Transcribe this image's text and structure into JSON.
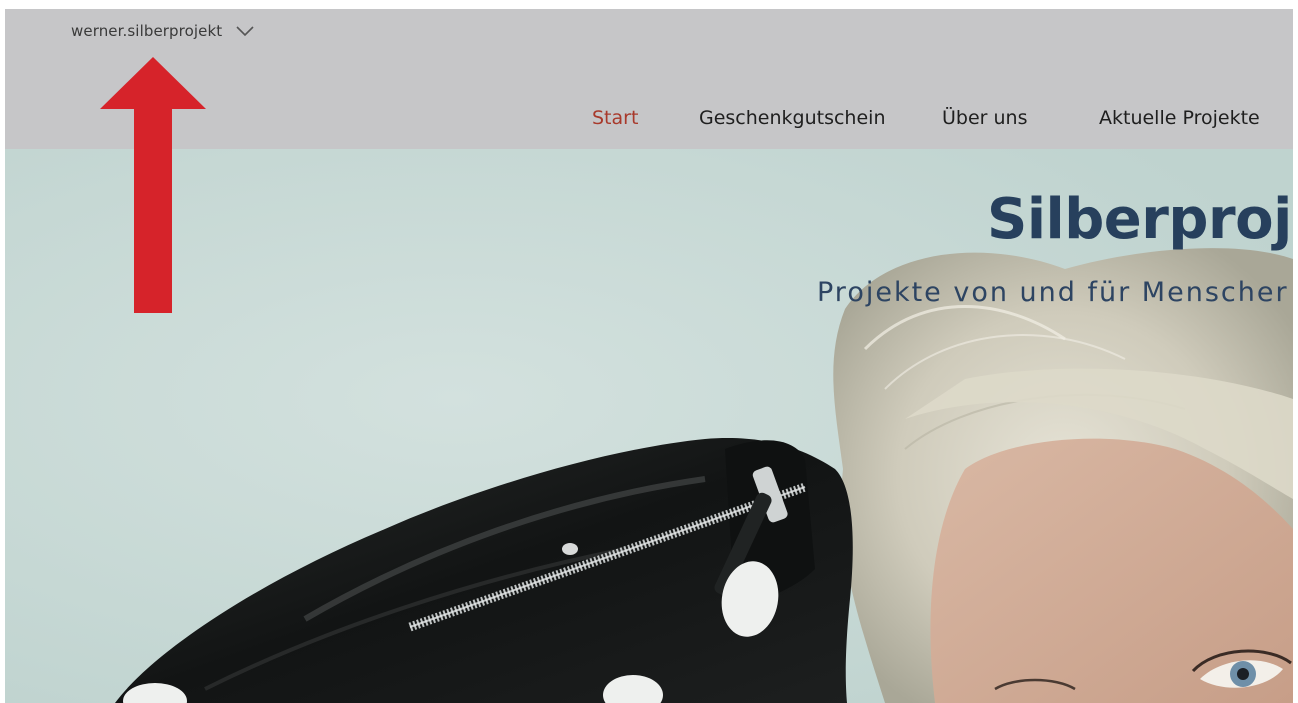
{
  "header": {
    "site_name": "werner.silberprojekt",
    "switcher_icon": "chevron-down-icon",
    "nav": [
      {
        "label": "Start",
        "active": true
      },
      {
        "label": "Geschenkgutschein",
        "active": false
      },
      {
        "label": "Über uns",
        "active": false
      },
      {
        "label": "Aktuelle Projekte",
        "active": false
      }
    ]
  },
  "hero": {
    "title": "Silberproj",
    "subtitle": "Projekte von und für Menscher"
  },
  "annotation": {
    "icon": "arrow-up-icon",
    "color": "#d6232a"
  },
  "colors": {
    "header_bg": "#c6c6c8",
    "active_nav": "#a8392b",
    "title": "#27405d",
    "hero_bg": "#c9d9d5"
  }
}
